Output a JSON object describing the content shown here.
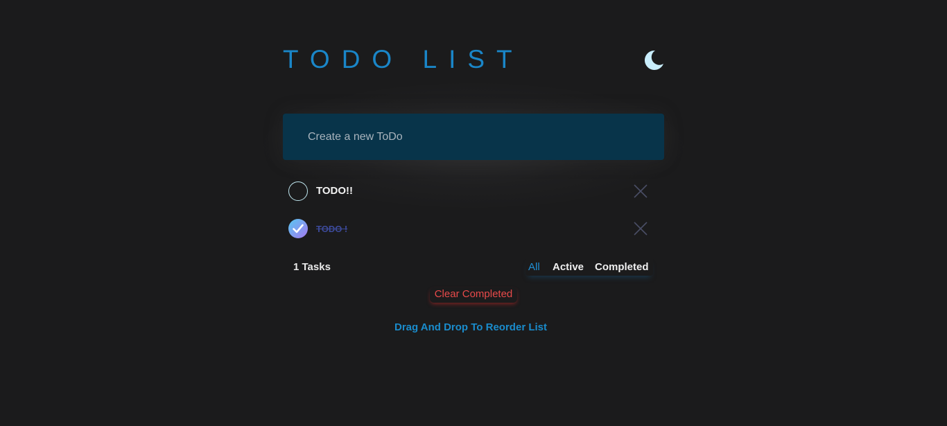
{
  "app": {
    "title": "TODO LIST"
  },
  "colors": {
    "background": "#1b1b1c",
    "accent": "#1a86c8",
    "input_background": "#08344a",
    "danger": "#e84a4a",
    "completed_text": "#3c4a9a"
  },
  "theme_toggle": {
    "icon": "moon-icon"
  },
  "new_todo": {
    "placeholder": "Create a new ToDo",
    "value": ""
  },
  "todos": [
    {
      "text": "TODO!!",
      "completed": false
    },
    {
      "text": "TODO !",
      "completed": true
    }
  ],
  "footer": {
    "count_label": "1 Tasks",
    "filters": [
      {
        "label": "All",
        "active": true
      },
      {
        "label": "Active",
        "active": false
      },
      {
        "label": "Completed",
        "active": false
      }
    ],
    "clear_completed_label": "Clear Completed",
    "reorder_hint": "Drag And Drop To Reorder List"
  }
}
